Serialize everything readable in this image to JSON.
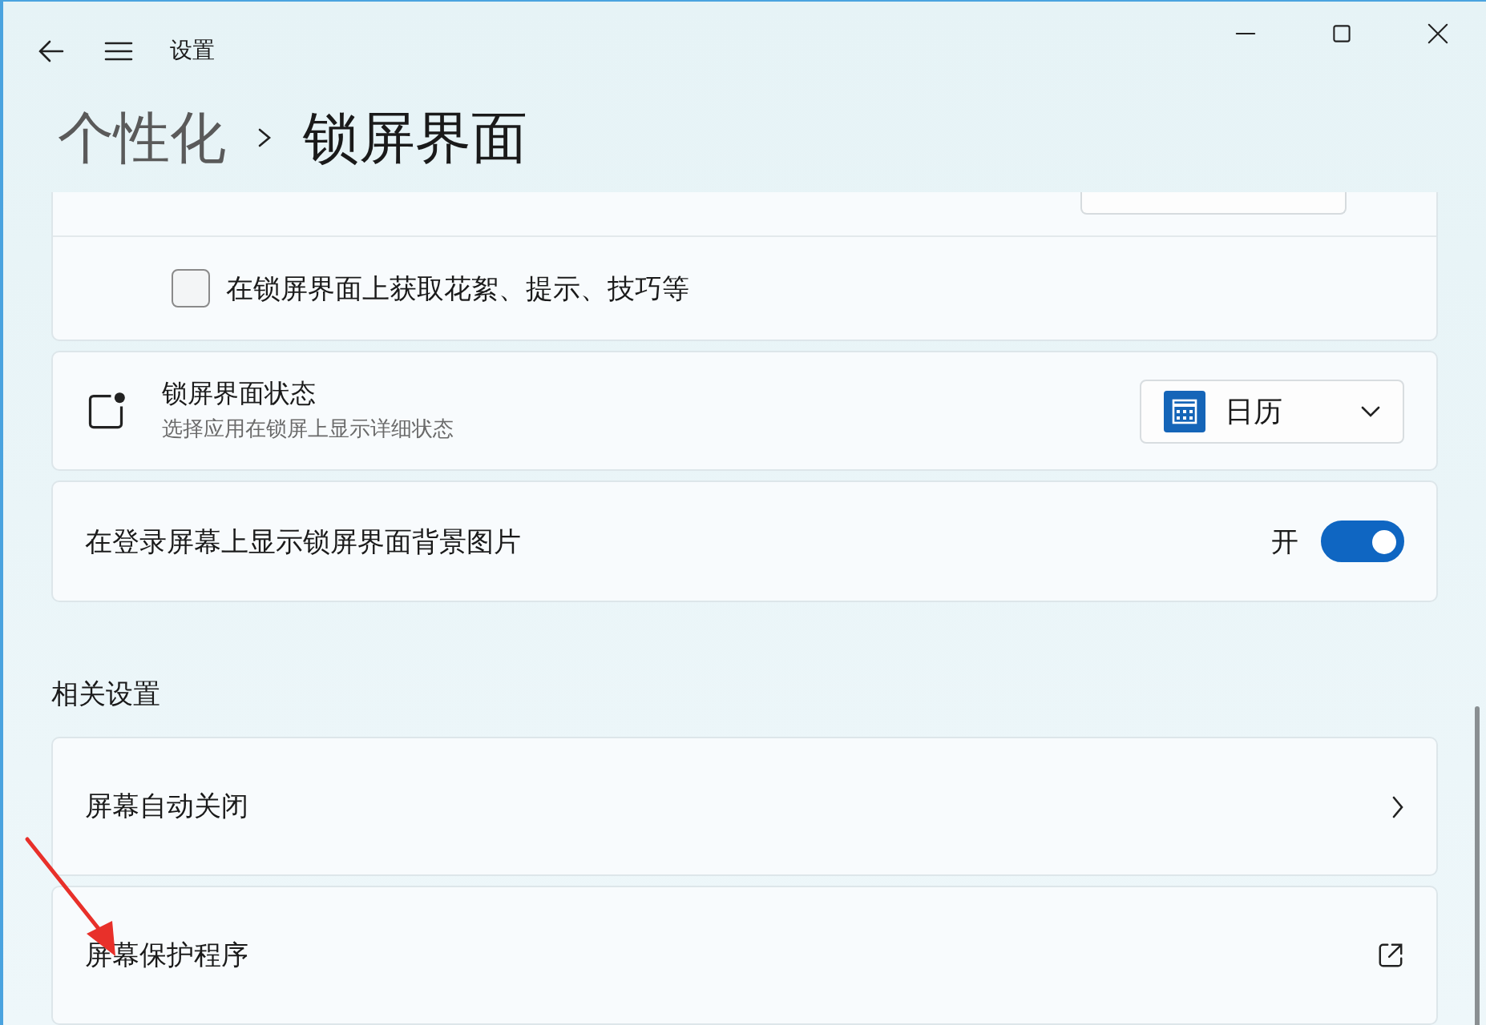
{
  "window": {
    "title": "设置"
  },
  "breadcrumb": [
    {
      "label": "个性化"
    },
    {
      "label": "锁屏界面"
    }
  ],
  "settings": [
    {
      "kind": "checkbox",
      "label": "在锁屏界面上获取花絮、提示、技巧等",
      "checked": false
    },
    {
      "kind": "dropdown",
      "title": "锁屏界面状态",
      "subtitle": "选择应用在锁屏上显示详细状态",
      "value": "日历"
    },
    {
      "kind": "toggle",
      "label": "在登录屏幕上显示锁屏界面背景图片",
      "state_label": "开",
      "on": true
    }
  ],
  "related": {
    "heading": "相关设置",
    "items": [
      {
        "kind": "chevron",
        "label": "屏幕自动关闭"
      },
      {
        "kind": "external",
        "label": "屏幕保护程序"
      }
    ]
  }
}
